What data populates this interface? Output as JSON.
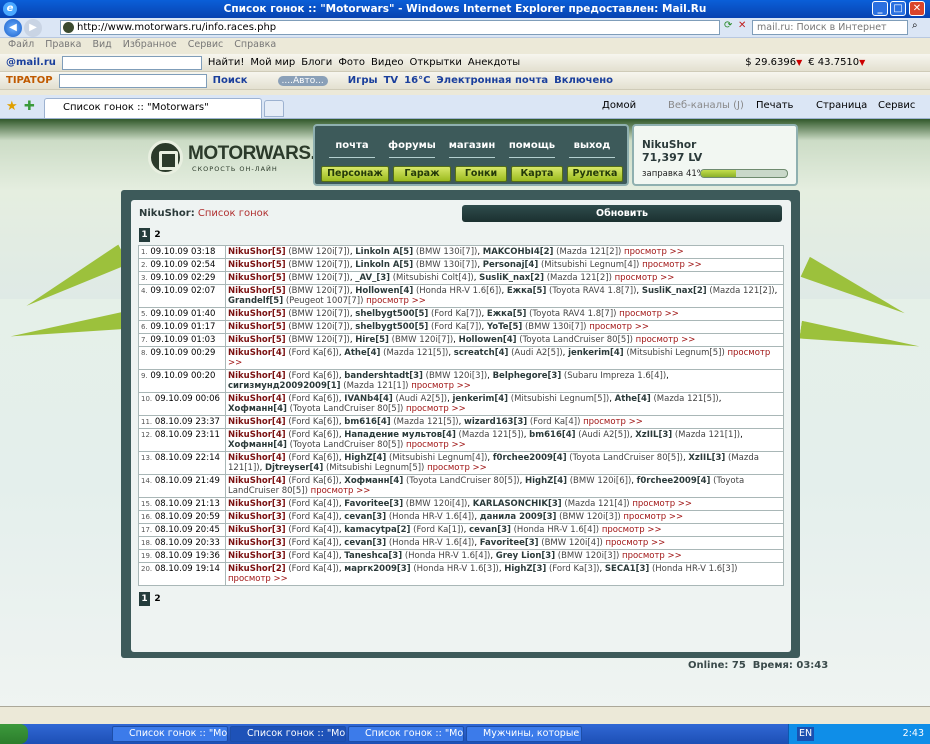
{
  "window": {
    "title": "Список гонок :: \"Motorwars\" - Windows Internet Explorer предоставлен: Mail.Ru",
    "icon": "ie-icon"
  },
  "address": {
    "url": "http://www.motorwars.ru/info.races.php",
    "search_placeholder": "mail.ru: Поиск в Интернет"
  },
  "menu": [
    "Файл",
    "Правка",
    "Вид",
    "Избранное",
    "Сервис",
    "Справка"
  ],
  "toolbar1": {
    "brand": "@mail.ru",
    "find": "Найти!",
    "items": [
      "Мой мир",
      "Блоги",
      "Фото",
      "Видео",
      "Открытки",
      "Анекдоты"
    ],
    "usd": "$ 29.6396",
    "eur": "€ 43.7510"
  },
  "toolbar2": {
    "brand": "TIPATOP",
    "search": "Поиск",
    "player": "....Авто...",
    "items": [
      "Игры",
      "TV",
      "16°C",
      "Электронная почта",
      "Включено"
    ]
  },
  "tabs": {
    "active": "Список гонок :: \"Motorwars\"",
    "right": [
      "Домой",
      "Веб-каналы (J)",
      "Печать",
      "Страница",
      "Сервис"
    ]
  },
  "logo": {
    "text": "MOTORWARS.RU",
    "sub": "СКОРОСТЬ ОН-ЛАЙН"
  },
  "nav": {
    "links": [
      "почта",
      "форумы",
      "магазин",
      "помощь",
      "выход"
    ],
    "buttons": [
      "Персонаж",
      "Гараж",
      "Гонки",
      "Карта",
      "Рулетка"
    ]
  },
  "user": {
    "name": "NikuShor",
    "money": "71,397 LV",
    "fuel_label": "заправка 41%",
    "fuel": 0.41
  },
  "list": {
    "user": "NikuShor:",
    "title": "Список гонок",
    "refresh": "Обновить",
    "pages": [
      "1",
      "2"
    ]
  },
  "races": [
    {
      "num": "1.",
      "date": "09.10.09 03:18",
      "players": [
        [
          "NikuShor[5]",
          "(BMW 120i[7])"
        ],
        [
          "Linkoln A[5]",
          "(BMW 130i[7])"
        ],
        [
          "MAKCOHbI4[2]",
          "(Mazda 121[2])"
        ]
      ]
    },
    {
      "num": "2.",
      "date": "09.10.09 02:54",
      "players": [
        [
          "NikuShor[5]",
          "(BMW 120i[7])"
        ],
        [
          "Linkoln A[5]",
          "(BMW 130i[7])"
        ],
        [
          "Personaj[4]",
          "(Mitsubishi Legnum[4])"
        ]
      ]
    },
    {
      "num": "3.",
      "date": "09.10.09 02:29",
      "players": [
        [
          "NikuShor[5]",
          "(BMW 120i[7])"
        ],
        [
          "_AV_[3]",
          "(Mitsubishi Colt[4])"
        ],
        [
          "SusliK_nax[2]",
          "(Mazda 121[2])"
        ]
      ]
    },
    {
      "num": "4.",
      "date": "09.10.09 02:07",
      "players": [
        [
          "NikuShor[5]",
          "(BMW 120i[7])"
        ],
        [
          "Hollowen[4]",
          "(Honda HR-V 1.6[6])"
        ],
        [
          "Ежка[5]",
          "(Toyota RAV4 1.8[7])"
        ],
        [
          "SusliK_nax[2]",
          "(Mazda 121[2])"
        ],
        [
          "Grandelf[5]",
          "(Peugeot 1007[7])"
        ]
      ]
    },
    {
      "num": "5.",
      "date": "09.10.09 01:40",
      "players": [
        [
          "NikuShor[5]",
          "(BMW 120i[7])"
        ],
        [
          "shelbygt500[5]",
          "(Ford Ka[7])"
        ],
        [
          "Ежка[5]",
          "(Toyota RAV4 1.8[7])"
        ]
      ]
    },
    {
      "num": "6.",
      "date": "09.10.09 01:17",
      "players": [
        [
          "NikuShor[5]",
          "(BMW 120i[7])"
        ],
        [
          "shelbygt500[5]",
          "(Ford Ka[7])"
        ],
        [
          "YoTe[5]",
          "(BMW 130i[7])"
        ]
      ]
    },
    {
      "num": "7.",
      "date": "09.10.09 01:03",
      "players": [
        [
          "NikuShor[5]",
          "(BMW 120i[7])"
        ],
        [
          "Hire[5]",
          "(BMW 120i[7])"
        ],
        [
          "Hollowen[4]",
          "(Toyota LandCruiser 80[5])"
        ]
      ]
    },
    {
      "num": "8.",
      "date": "09.10.09 00:29",
      "players": [
        [
          "NikuShor[4]",
          "(Ford Ka[6])"
        ],
        [
          "Athe[4]",
          "(Mazda 121[5])"
        ],
        [
          "screatch[4]",
          "(Audi A2[5])"
        ],
        [
          "jenkerim[4]",
          "(Mitsubishi Legnum[5])"
        ]
      ]
    },
    {
      "num": "9.",
      "date": "09.10.09 00:20",
      "players": [
        [
          "NikuShor[4]",
          "(Ford Ka[6])"
        ],
        [
          "bandershtadt[3]",
          "(BMW 120i[3])"
        ],
        [
          "Belphegore[3]",
          "(Subaru Impreza 1.6[4])"
        ],
        [
          "сигизмунд20092009[1]",
          "(Mazda 121[1])"
        ]
      ]
    },
    {
      "num": "10.",
      "date": "09.10.09 00:06",
      "players": [
        [
          "NikuShor[4]",
          "(Ford Ka[6])"
        ],
        [
          "IVANb4[4]",
          "(Audi A2[5])"
        ],
        [
          "jenkerim[4]",
          "(Mitsubishi Legnum[5])"
        ],
        [
          "Athe[4]",
          "(Mazda 121[5])"
        ],
        [
          "Хофманн[4]",
          "(Toyota LandCruiser 80[5])"
        ]
      ]
    },
    {
      "num": "11.",
      "date": "08.10.09 23:37",
      "players": [
        [
          "NikuShor[4]",
          "(Ford Ka[6])"
        ],
        [
          "bm616[4]",
          "(Mazda 121[5])"
        ],
        [
          "wizard163[3]",
          "(Ford Ka[4])"
        ]
      ]
    },
    {
      "num": "12.",
      "date": "08.10.09 23:11",
      "players": [
        [
          "NikuShor[4]",
          "(Ford Ka[6])"
        ],
        [
          "Нападение мультов[4]",
          "(Mazda 121[5])"
        ],
        [
          "bm616[4]",
          "(Audi A2[5])"
        ],
        [
          "XzIIL[3]",
          "(Mazda 121[1])"
        ],
        [
          "Хофманн[4]",
          "(Toyota LandCruiser 80[5])"
        ]
      ]
    },
    {
      "num": "13.",
      "date": "08.10.09 22:14",
      "players": [
        [
          "NikuShor[4]",
          "(Ford Ka[6])"
        ],
        [
          "HighZ[4]",
          "(Mitsubishi Legnum[4])"
        ],
        [
          "f0rchee2009[4]",
          "(Toyota LandCruiser 80[5])"
        ],
        [
          "XzIIL[3]",
          "(Mazda 121[1])"
        ],
        [
          "Djtreyser[4]",
          "(Mitsubishi Legnum[5])"
        ]
      ]
    },
    {
      "num": "14.",
      "date": "08.10.09 21:49",
      "players": [
        [
          "NikuShor[4]",
          "(Ford Ka[6])"
        ],
        [
          "Хофманн[4]",
          "(Toyota LandCruiser 80[5])"
        ],
        [
          "HighZ[4]",
          "(BMW 120i[6])"
        ],
        [
          "f0rchee2009[4]",
          "(Toyota LandCruiser 80[5])"
        ]
      ]
    },
    {
      "num": "15.",
      "date": "08.10.09 21:13",
      "players": [
        [
          "NikuShor[3]",
          "(Ford Ka[4])"
        ],
        [
          "Favoritee[3]",
          "(BMW 120i[4])"
        ],
        [
          "KARLASONCHIK[3]",
          "(Mazda 121[4])"
        ]
      ]
    },
    {
      "num": "16.",
      "date": "08.10.09 20:59",
      "players": [
        [
          "NikuShor[3]",
          "(Ford Ka[4])"
        ],
        [
          "cevan[3]",
          "(Honda HR-V 1.6[4])"
        ],
        [
          "данила 2009[3]",
          "(BMW 120i[3])"
        ]
      ]
    },
    {
      "num": "17.",
      "date": "08.10.09 20:45",
      "players": [
        [
          "NikuShor[3]",
          "(Ford Ka[4])"
        ],
        [
          "kamacytpa[2]",
          "(Ford Ka[1])"
        ],
        [
          "cevan[3]",
          "(Honda HR-V 1.6[4])"
        ]
      ]
    },
    {
      "num": "18.",
      "date": "08.10.09 20:33",
      "players": [
        [
          "NikuShor[3]",
          "(Ford Ka[4])"
        ],
        [
          "cevan[3]",
          "(Honda HR-V 1.6[4])"
        ],
        [
          "Favoritee[3]",
          "(BMW 120i[4])"
        ]
      ]
    },
    {
      "num": "19.",
      "date": "08.10.09 19:36",
      "players": [
        [
          "NikuShor[3]",
          "(Ford Ka[4])"
        ],
        [
          "Taneshca[3]",
          "(Honda HR-V 1.6[4])"
        ],
        [
          "Grey Lion[3]",
          "(BMW 120i[3])"
        ]
      ]
    },
    {
      "num": "20.",
      "date": "08.10.09 19:14",
      "players": [
        [
          "NikuShor[2]",
          "(Ford Ka[4])"
        ],
        [
          "маргк2009[3]",
          "(Honda HR-V 1.6[3])"
        ],
        [
          "HighZ[3]",
          "(Ford Ka[3])"
        ],
        [
          "SECA1[3]",
          "(Honda HR-V 1.6[3])"
        ]
      ]
    }
  ],
  "view_label": "просмотр >>",
  "footer": {
    "online": "Online: 75",
    "time": "Время: 03:43"
  },
  "taskbar": {
    "tasks": [
      "Список гонок :: \"Мо...",
      "Список гонок :: \"Мо...",
      "Список гонок :: \"Мо...",
      "Мужчины, которые ..."
    ],
    "lang": "EN",
    "clock": "2:43"
  }
}
